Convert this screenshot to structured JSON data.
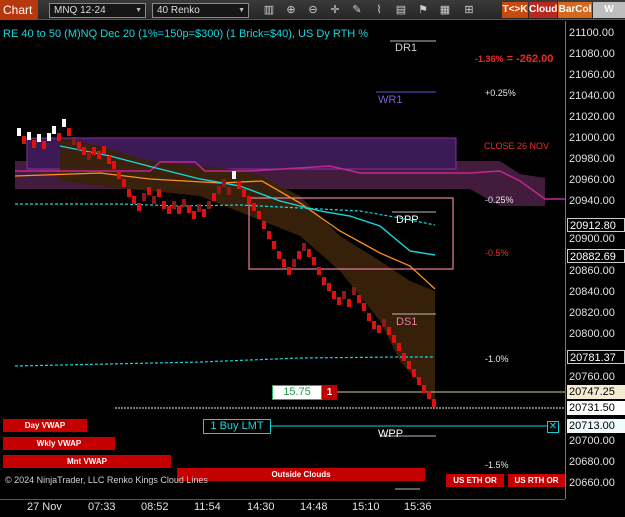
{
  "toolbar": {
    "title": "Chart",
    "instrument": "MNQ 12-24",
    "bar_type": "40 Renko",
    "icons": [
      "bars-icon",
      "zoom-in-icon",
      "zoom-out-icon",
      "crosshair-icon",
      "draw-tools-icon",
      "shapes-icon",
      "properties-icon",
      "strategies-icon",
      "data-box-icon",
      "lock-icon"
    ],
    "buttons": {
      "tk": "T<>K",
      "cloud": "Cloud",
      "barcol": "BarCol",
      "vwap": "W VWA"
    },
    "button_colors": {
      "tk": "#c84a10",
      "cloud": "#b8281e",
      "barcol": "#d2691e",
      "vwap": "#bdbdbd"
    }
  },
  "header": {
    "title": "RE 40 to 50 (M)NQ Dec 20 (1%=150p=$300) (1 Brick=$40), US Dy RTH %",
    "pnl": "-262.00",
    "pnl_pct": "-1.36%"
  },
  "pivots": {
    "dr1": "DR1",
    "wr1": "WR1",
    "dpp": "DPP",
    "ds1": "DS1",
    "wpp": "WPP",
    "close": "CLOSE 26 NOV"
  },
  "percent_labels": [
    "+0.25%",
    "-0.25%",
    "-0.5%",
    "-1.0%",
    "-1.5%"
  ],
  "price_axis": {
    "ticks": [
      "21100.00",
      "21080.00",
      "21060.00",
      "21040.00",
      "21020.00",
      "21000.00",
      "20980.00",
      "20960.00",
      "20940.00",
      "20900.00",
      "20860.00",
      "20840.00",
      "20820.00",
      "20800.00",
      "20760.00",
      "20700.00",
      "20680.00",
      "20660.00"
    ],
    "markers": {
      "pp1": "20912.80",
      "pp2": "20882.69",
      "vwap": "20781.37",
      "order": "20747.25",
      "last": "20731.50",
      "buy": "20713.00"
    }
  },
  "time_axis": [
    "27 Nov",
    "07:33",
    "08:52",
    "11:54",
    "14:30",
    "14:48",
    "15:10",
    "15:36"
  ],
  "order": {
    "qty": "15.75",
    "count": "1",
    "buy_label": "1 Buy LMT",
    "cancel": "✕"
  },
  "buttons": {
    "day_vwap": "Day VWAP",
    "wkly_vwap": "Wkly VWAP",
    "mnt_vwap": "Mnt VWAP",
    "outside_clouds": "Outside Clouds",
    "us_eth_or": "US ETH OR",
    "us_rth_or": "US RTH OR"
  },
  "copyright": "© 2024 NinjaTrader, LLC  Renko Kings Cloud Lines",
  "colors": {
    "up_brick": "#ffffff",
    "down_brick": "#e01010",
    "neutral_brick": "#8c1a1a",
    "cyan": "#13d8e0",
    "orange": "#ff9020",
    "magenta": "#c02890",
    "background": "#000000"
  }
}
